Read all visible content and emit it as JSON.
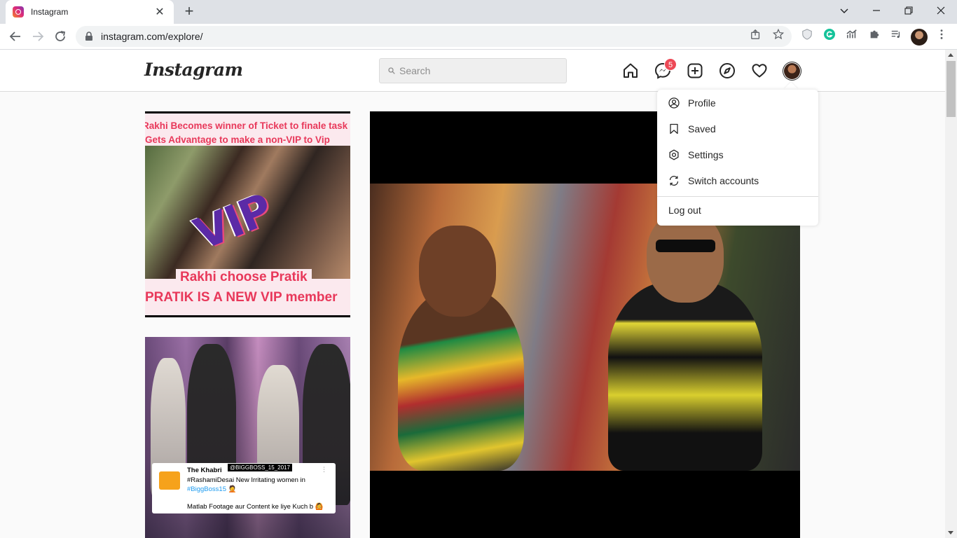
{
  "browser": {
    "tab_title": "Instagram",
    "url": "instagram.com/explore/"
  },
  "instagram": {
    "logo_text": "Instagram",
    "search_placeholder": "Search",
    "messages_badge": "5"
  },
  "menu": {
    "items": [
      {
        "label": "Profile",
        "icon": "profile-icon"
      },
      {
        "label": "Saved",
        "icon": "bookmark-icon"
      },
      {
        "label": "Settings",
        "icon": "settings-icon"
      },
      {
        "label": "Switch accounts",
        "icon": "switch-accounts-icon"
      }
    ],
    "logout_label": "Log out"
  },
  "posts": {
    "post1": {
      "caption_line1": "Rakhi Becomes winner of Ticket to finale task",
      "caption_line2": "Gets Advantage to make a non-VIP to Vip",
      "overlay_text": "VIP",
      "bottom_line1": "Rakhi choose Pratik",
      "bottom_line2": "PRATIK IS A NEW VIP member"
    },
    "post2": {
      "tweet_name": "The Khabri",
      "tweet_handle": "@BIGGBOSS_15_2017",
      "tweet_line1": "#RashamiDesai New Irritating women in",
      "tweet_line2": "#BiggBoss15 🤦",
      "tweet_line3": "Matlab Footage aur Content ke liye Kuch b 🙆"
    }
  },
  "colors": {
    "badge": "#ed4956",
    "chrome_tabstrip": "#dee1e6",
    "page_bg": "#fafafa"
  }
}
